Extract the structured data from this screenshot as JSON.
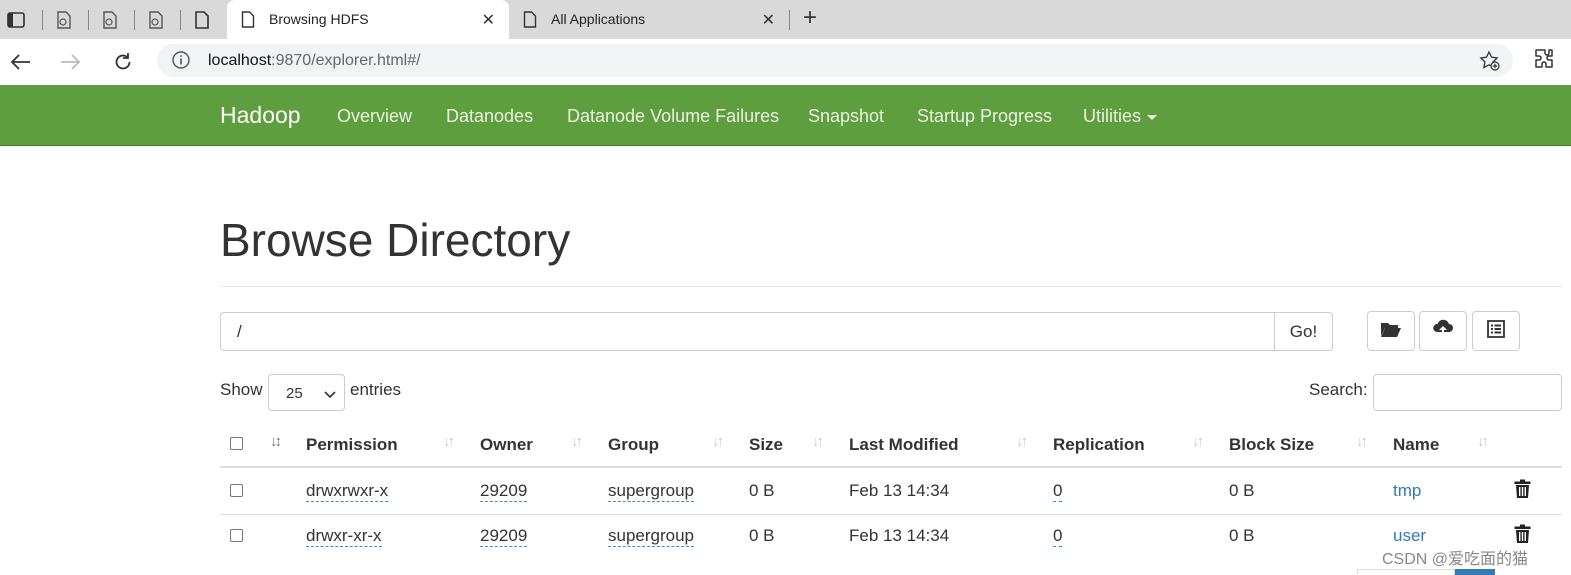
{
  "browser": {
    "tabs": [
      {
        "title": "Browsing HDFS",
        "active": true,
        "icon": "page-icon"
      },
      {
        "title": "All Applications",
        "active": false,
        "icon": "page-icon"
      }
    ],
    "new_tab_label": "+",
    "close_label": "✕",
    "url_host": "localhost",
    "url_rest": ":9870/explorer.html#/"
  },
  "navbar": {
    "brand": "Hadoop",
    "links": [
      "Overview",
      "Datanodes",
      "Datanode Volume Failures",
      "Snapshot",
      "Startup Progress",
      "Utilities"
    ],
    "color": "#5e9e3f"
  },
  "page": {
    "title": "Browse Directory",
    "path_value": "/",
    "go_label": "Go!",
    "show_label": "Show",
    "entries_select": "25",
    "entries_label": "entries",
    "search_label": "Search:"
  },
  "table": {
    "headers": [
      "Permission",
      "Owner",
      "Group",
      "Size",
      "Last Modified",
      "Replication",
      "Block Size",
      "Name"
    ],
    "rows": [
      {
        "permission": "drwxrwxr-x",
        "owner": "29209",
        "group": "supergroup",
        "size": "0 B",
        "modified": "Feb 13 14:34",
        "replication": "0",
        "block_size": "0 B",
        "name": "tmp"
      },
      {
        "permission": "drwxr-xr-x",
        "owner": "29209",
        "group": "supergroup",
        "size": "0 B",
        "modified": "Feb 13 14:34",
        "replication": "0",
        "block_size": "0 B",
        "name": "user"
      }
    ]
  },
  "watermark": "CSDN @爱吃面的猫"
}
